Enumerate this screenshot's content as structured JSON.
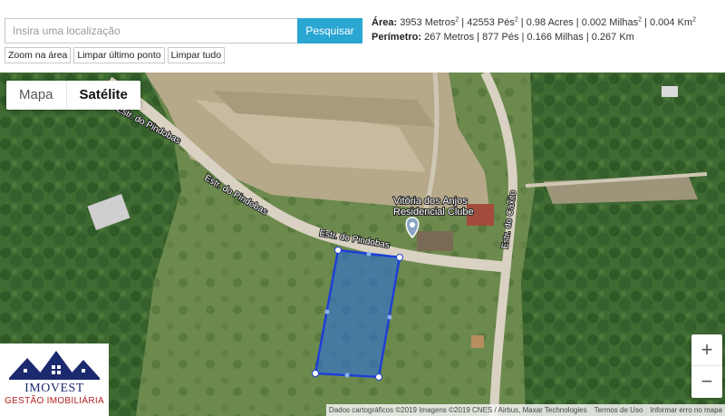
{
  "search": {
    "placeholder": "Insira uma localização",
    "value": "",
    "button_label": "Pesquisar"
  },
  "tools": {
    "zoom_area": "Zoom na área",
    "clear_last": "Limpar último ponto",
    "clear_all": "Limpar tudo"
  },
  "measurements": {
    "area_label": "Área:",
    "area_m": "3953 Metros",
    "area_ft": "42553 Pés",
    "area_acres": "0.98 Acres",
    "area_mi": "0.002 Milhas",
    "area_km": "0.004 Km",
    "sep": " | ",
    "sup": "2",
    "perimeter_label": "Perímetro:",
    "perimeter_text": "267 Metros | 877 Pés | 0.166 Milhas | 0.267 Km"
  },
  "map": {
    "type_map": "Mapa",
    "type_satellite": "Satélite",
    "active_type": "Satélite",
    "labels": {
      "road_1": "Estr. do Pindobas",
      "road_2": "Estr. do Pindobas",
      "road_3": "Estr. do Pindobas",
      "road_caxito": "Estr. do Caxito",
      "place_line1": "Vitória dos Anjos",
      "place_line2": "Residencial Clube"
    },
    "zoom_in": "+",
    "zoom_out": "−",
    "attribution": {
      "data": "Dados cartográficos ©2019 Imagens ©2019 CNES / Airbus, Maxar Technologies",
      "terms": "Termos de Uso",
      "report": "Informar erro no mapa"
    },
    "polygon_color": "#1e3fd6"
  },
  "logo": {
    "name": "IMOVEST",
    "tagline": "GESTÃO IMOBILIÁRIA"
  }
}
